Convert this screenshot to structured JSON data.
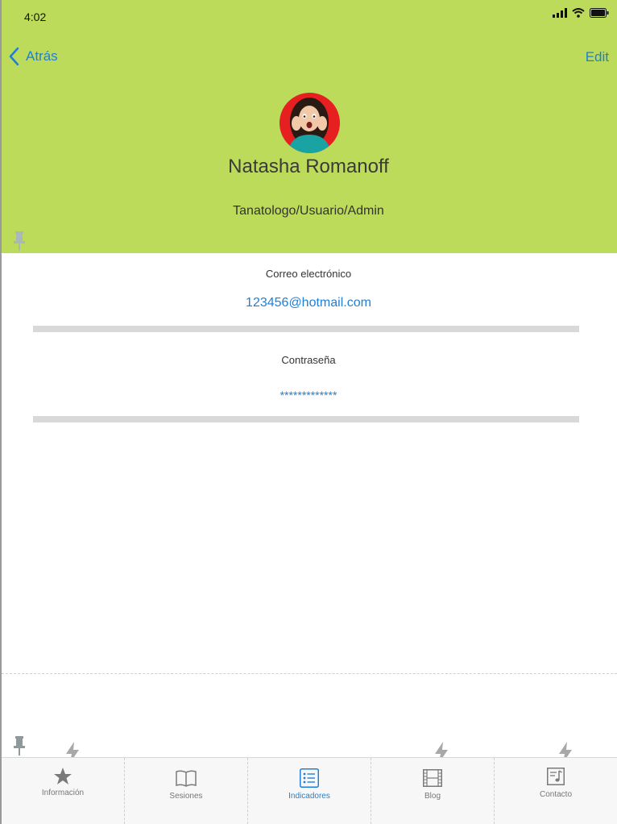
{
  "status_bar": {
    "time": "4:02"
  },
  "nav": {
    "back_label": "Atrás",
    "edit_label": "Edit"
  },
  "profile": {
    "name": "Natasha Romanoff",
    "role": "Tanatologo/Usuario/Admin"
  },
  "fields": {
    "email": {
      "label": "Correo electrónico",
      "value": "123456@hotmail.com"
    },
    "password": {
      "label": "Contraseña",
      "value": "*************"
    }
  },
  "tabs": [
    {
      "label": "Información",
      "icon": "star-icon"
    },
    {
      "label": "Sesiones",
      "icon": "book-icon"
    },
    {
      "label": "Indicadores",
      "icon": "list-icon",
      "active": true
    },
    {
      "label": "Blog",
      "icon": "film-icon"
    },
    {
      "label": "Contacto",
      "icon": "music-note-icon"
    }
  ],
  "colors": {
    "header_bg": "#bddb5b",
    "accent": "#1f7fd6",
    "divider": "#d9d9d9"
  }
}
